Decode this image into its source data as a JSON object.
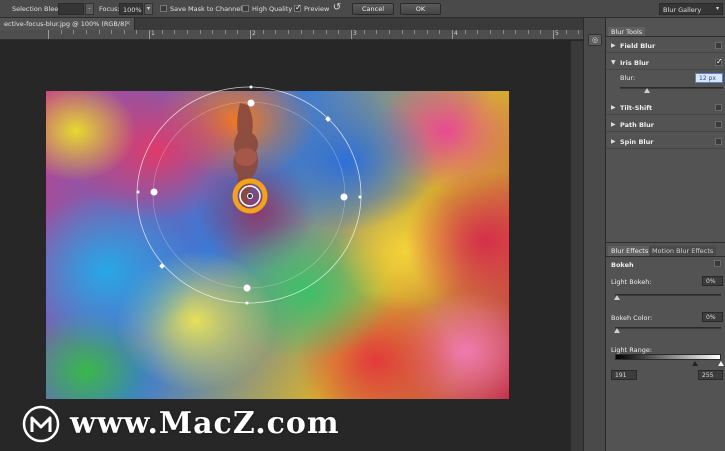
{
  "options_bar": {
    "selection_bleed_label": "Selection Bleed:",
    "focus_label": "Focus:",
    "focus_value": "100%",
    "save_mask_label": "Save Mask to Channels",
    "high_quality_label": "High Quality",
    "preview_label": "Preview",
    "cancel_label": "Cancel",
    "ok_label": "OK",
    "gallery_value": "Blur Gallery",
    "save_mask_checked": false,
    "high_quality_checked": false,
    "preview_checked": true
  },
  "document": {
    "tab_title": "ective-focus-blur.jpg @ 100% (RGB/8)",
    "close_glyph": "×"
  },
  "ruler": {
    "labels": [
      "1",
      "2",
      "3",
      "4",
      "5"
    ]
  },
  "blur_tools": {
    "tab_label": "Blur Tools",
    "items": [
      {
        "name": "Field Blur",
        "expanded": false,
        "checked": false
      },
      {
        "name": "Iris Blur",
        "expanded": true,
        "checked": true
      },
      {
        "name": "Tilt-Shift",
        "expanded": false,
        "checked": false
      },
      {
        "name": "Path Blur",
        "expanded": false,
        "checked": false
      },
      {
        "name": "Spin Blur",
        "expanded": false,
        "checked": false
      }
    ],
    "iris_blur_label": "Blur:",
    "iris_blur_value": "12 px",
    "iris_blur_level": 0.12
  },
  "blur_effects": {
    "tab_label": "Blur Effects",
    "tab2_label": "Motion Blur Effects",
    "bokeh_label": "Bokeh",
    "bokeh_checked": true,
    "light_bokeh_label": "Light Bokeh:",
    "light_bokeh_value": "0%",
    "bokeh_color_label": "Bokeh Color:",
    "bokeh_color_value": "0%",
    "light_range_label": "Light Range:",
    "light_range_low": "191",
    "light_range_high": "255"
  },
  "watermark": {
    "text": "www.MacZ.com"
  },
  "icons": {
    "reset": "reset-pins-icon",
    "expand": "triangle-right-icon",
    "collapse": "triangle-down-icon"
  },
  "colors": {
    "panel_bg": "#535353",
    "options_bg": "#4a4a4a",
    "pin_orange": "#f4a21c",
    "selection_blue": "#5b86c9"
  }
}
